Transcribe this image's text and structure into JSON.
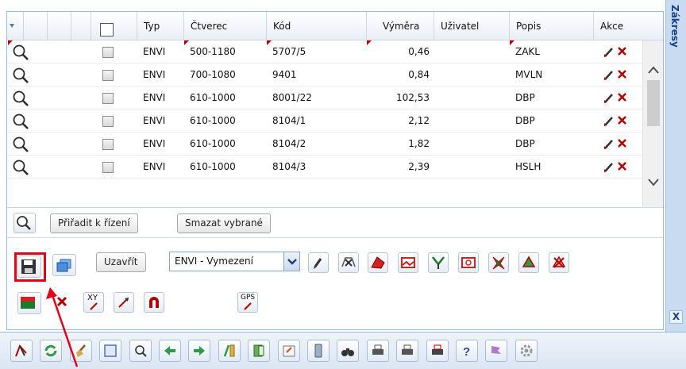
{
  "sidebar": {
    "title": "Zákresy",
    "close_label": "X"
  },
  "grid": {
    "columns": [
      "Typ",
      "Čtverec",
      "Kód",
      "Výměra",
      "Uživatel",
      "Popis",
      "Akce"
    ],
    "rows": [
      {
        "typ": "ENVI",
        "ctverec": "500-1180",
        "kod": "5707/5",
        "vymera": "0,46",
        "uzivatel": "",
        "popis": "ZAKL"
      },
      {
        "typ": "ENVI",
        "ctverec": "700-1080",
        "kod": "9401",
        "vymera": "0,84",
        "uzivatel": "",
        "popis": "MVLN"
      },
      {
        "typ": "ENVI",
        "ctverec": "610-1000",
        "kod": "8001/22",
        "vymera": "102,53",
        "uzivatel": "",
        "popis": "DBP"
      },
      {
        "typ": "ENVI",
        "ctverec": "610-1000",
        "kod": "8104/1",
        "vymera": "2,12",
        "uzivatel": "",
        "popis": "DBP"
      },
      {
        "typ": "ENVI",
        "ctverec": "610-1000",
        "kod": "8104/2",
        "vymera": "1,82",
        "uzivatel": "",
        "popis": "DBP"
      },
      {
        "typ": "ENVI",
        "ctverec": "610-1000",
        "kod": "8104/3",
        "vymera": "2,39",
        "uzivatel": "",
        "popis": "HSLH"
      }
    ]
  },
  "grid_bar": {
    "assign_label": "Přiřadit k řízení",
    "delete_selected_label": "Smazat vybrané"
  },
  "tools": {
    "close_label": "Uzavřít",
    "layer_select_value": "ENVI - Vymezení",
    "gps_label": "GPS",
    "xy_label": "XY"
  },
  "colors": {
    "accent": "#99bbe8",
    "highlight": "#e2001a"
  },
  "icons": {
    "row": [
      "zoom-icon",
      "edit-pencil-icon",
      "delete-x-icon"
    ],
    "bottom_toolbar": [
      "draw-icon",
      "refresh-icon",
      "broom-icon",
      "window-icon",
      "zoom-extent-icon",
      "back-icon",
      "forward-icon",
      "measure-icon",
      "book-icon",
      "export-icon",
      "phone-icon",
      "binoculars-icon",
      "print-icon",
      "print-icon-2",
      "print-icon-3",
      "help-icon",
      "flag-icon",
      "settings-icon"
    ]
  }
}
